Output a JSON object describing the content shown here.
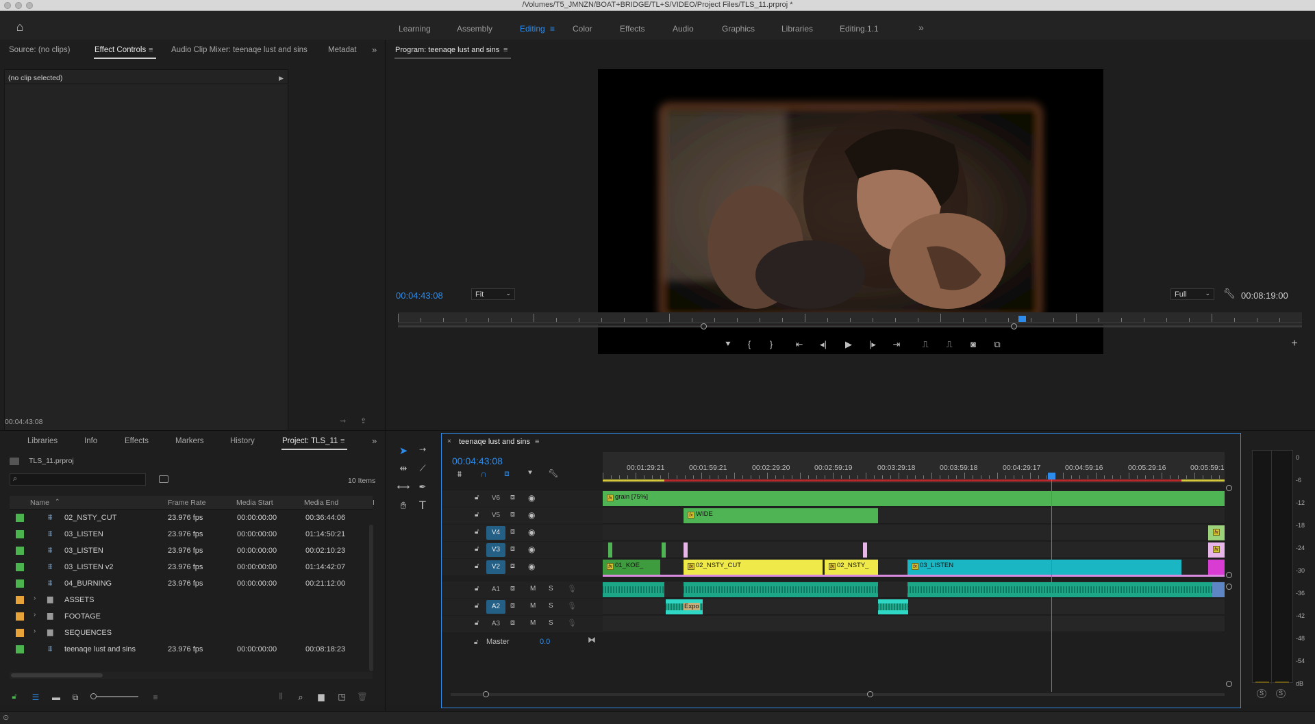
{
  "window": {
    "title": "/Volumes/T5_JMNZN/BOAT+BRIDGE/TL+S/VIDEO/Project Files/TLS_11.prproj *"
  },
  "workspaces": {
    "items": [
      {
        "label": "Learning"
      },
      {
        "label": "Assembly"
      },
      {
        "label": "Editing"
      },
      {
        "label": "Color"
      },
      {
        "label": "Effects"
      },
      {
        "label": "Audio"
      },
      {
        "label": "Graphics"
      },
      {
        "label": "Libraries"
      },
      {
        "label": "Editing.1.1"
      }
    ],
    "more": "»"
  },
  "source_panel": {
    "tabs": [
      {
        "label": "Source: (no clips)"
      },
      {
        "label": "Effect Controls"
      },
      {
        "label": "Audio Clip Mixer: teenaqe lust and sins"
      },
      {
        "label": "Metadat"
      }
    ],
    "no_clip": "(no clip selected)",
    "timecode": "00:04:43:08"
  },
  "program_monitor": {
    "title": "Program: teenaqe lust and sins",
    "timecode": "00:04:43:08",
    "fit": "Fit",
    "resolution": "Full",
    "duration": "00:08:19:00",
    "playhead_fraction": 0.69
  },
  "project_panel": {
    "tabs": [
      {
        "label": "Libraries"
      },
      {
        "label": "Info"
      },
      {
        "label": "Effects"
      },
      {
        "label": "Markers"
      },
      {
        "label": "History"
      },
      {
        "label": "Project: TLS_11"
      }
    ],
    "project_file": "TLS_11.prproj",
    "item_count": "10 Items",
    "columns": {
      "name": "Name",
      "frame_rate": "Frame Rate",
      "media_start": "Media Start",
      "media_end": "Media End"
    },
    "rows": [
      {
        "name": "02_NSTY_CUT",
        "fps": "23.976 fps",
        "start": "00:00:00:00",
        "end": "00:36:44:06",
        "color": "#4cb44e",
        "type": "seq"
      },
      {
        "name": "03_LISTEN",
        "fps": "23.976 fps",
        "start": "00:00:00:00",
        "end": "01:14:50:21",
        "color": "#4cb44e",
        "type": "seq"
      },
      {
        "name": "03_LISTEN",
        "fps": "23.976 fps",
        "start": "00:00:00:00",
        "end": "00:02:10:23",
        "color": "#4cb44e",
        "type": "seq"
      },
      {
        "name": "03_LISTEN v2",
        "fps": "23.976 fps",
        "start": "00:00:00:00",
        "end": "01:14:42:07",
        "color": "#4cb44e",
        "type": "seq"
      },
      {
        "name": "04_BURNING",
        "fps": "23.976 fps",
        "start": "00:00:00:00",
        "end": "00:21:12:00",
        "color": "#4cb44e",
        "type": "seq"
      },
      {
        "name": "ASSETS",
        "fps": "",
        "start": "",
        "end": "",
        "color": "#e8a23a",
        "type": "folder"
      },
      {
        "name": "FOOTAGE",
        "fps": "",
        "start": "",
        "end": "",
        "color": "#e8a23a",
        "type": "folder"
      },
      {
        "name": "SEQUENCES",
        "fps": "",
        "start": "",
        "end": "",
        "color": "#e8a23a",
        "type": "folder"
      },
      {
        "name": "teenaqe lust and sins",
        "fps": "23.976 fps",
        "start": "00:00:00:00",
        "end": "00:08:18:23",
        "color": "#4cb44e",
        "type": "seq"
      }
    ]
  },
  "timeline": {
    "sequence_name": "teenaqe lust and sins",
    "timecode": "00:04:43:08",
    "ruler": [
      "00:01:29:21",
      "00:01:59:21",
      "00:02:29:20",
      "00:02:59:19",
      "00:03:29:18",
      "00:03:59:18",
      "00:04:29:17",
      "00:04:59:16",
      "00:05:29:16",
      "00:05:59:1"
    ],
    "tracks": [
      {
        "id": "V6",
        "kind": "video"
      },
      {
        "id": "V5",
        "kind": "video"
      },
      {
        "id": "V4",
        "kind": "video"
      },
      {
        "id": "V3",
        "kind": "video"
      },
      {
        "id": "V2",
        "kind": "video"
      },
      {
        "id": "A1",
        "kind": "audio"
      },
      {
        "id": "A2",
        "kind": "audio"
      },
      {
        "id": "A3",
        "kind": "audio"
      }
    ],
    "master": {
      "label": "Master",
      "value": "0.0"
    },
    "clips": {
      "grain": "grain [75%]",
      "wide": "WIDE",
      "koe": "01_KOE_",
      "nsty": "02_NSTY_CUT",
      "nsty2": "02_NSTY_",
      "listen": "03_LISTEN",
      "expo": "Expo"
    },
    "track_buttons": {
      "m": "M",
      "s": "S"
    }
  },
  "meter": {
    "scale": [
      "0",
      "-6",
      "-12",
      "-18",
      "-24",
      "-30",
      "-36",
      "-42",
      "-48",
      "-54",
      "dB"
    ],
    "solo": [
      "S",
      "S"
    ]
  },
  "icons": [
    "home-icon",
    "menu-icon",
    "play-icon",
    "step-back-icon",
    "step-forward-icon",
    "camera-icon",
    "wrench-icon",
    "plus-icon",
    "selection-tool-icon",
    "razor-icon",
    "pen-icon",
    "hand-icon",
    "type-icon",
    "magnet-icon",
    "lock-icon",
    "eye-icon",
    "mic-icon",
    "search-icon",
    "folder-icon"
  ]
}
